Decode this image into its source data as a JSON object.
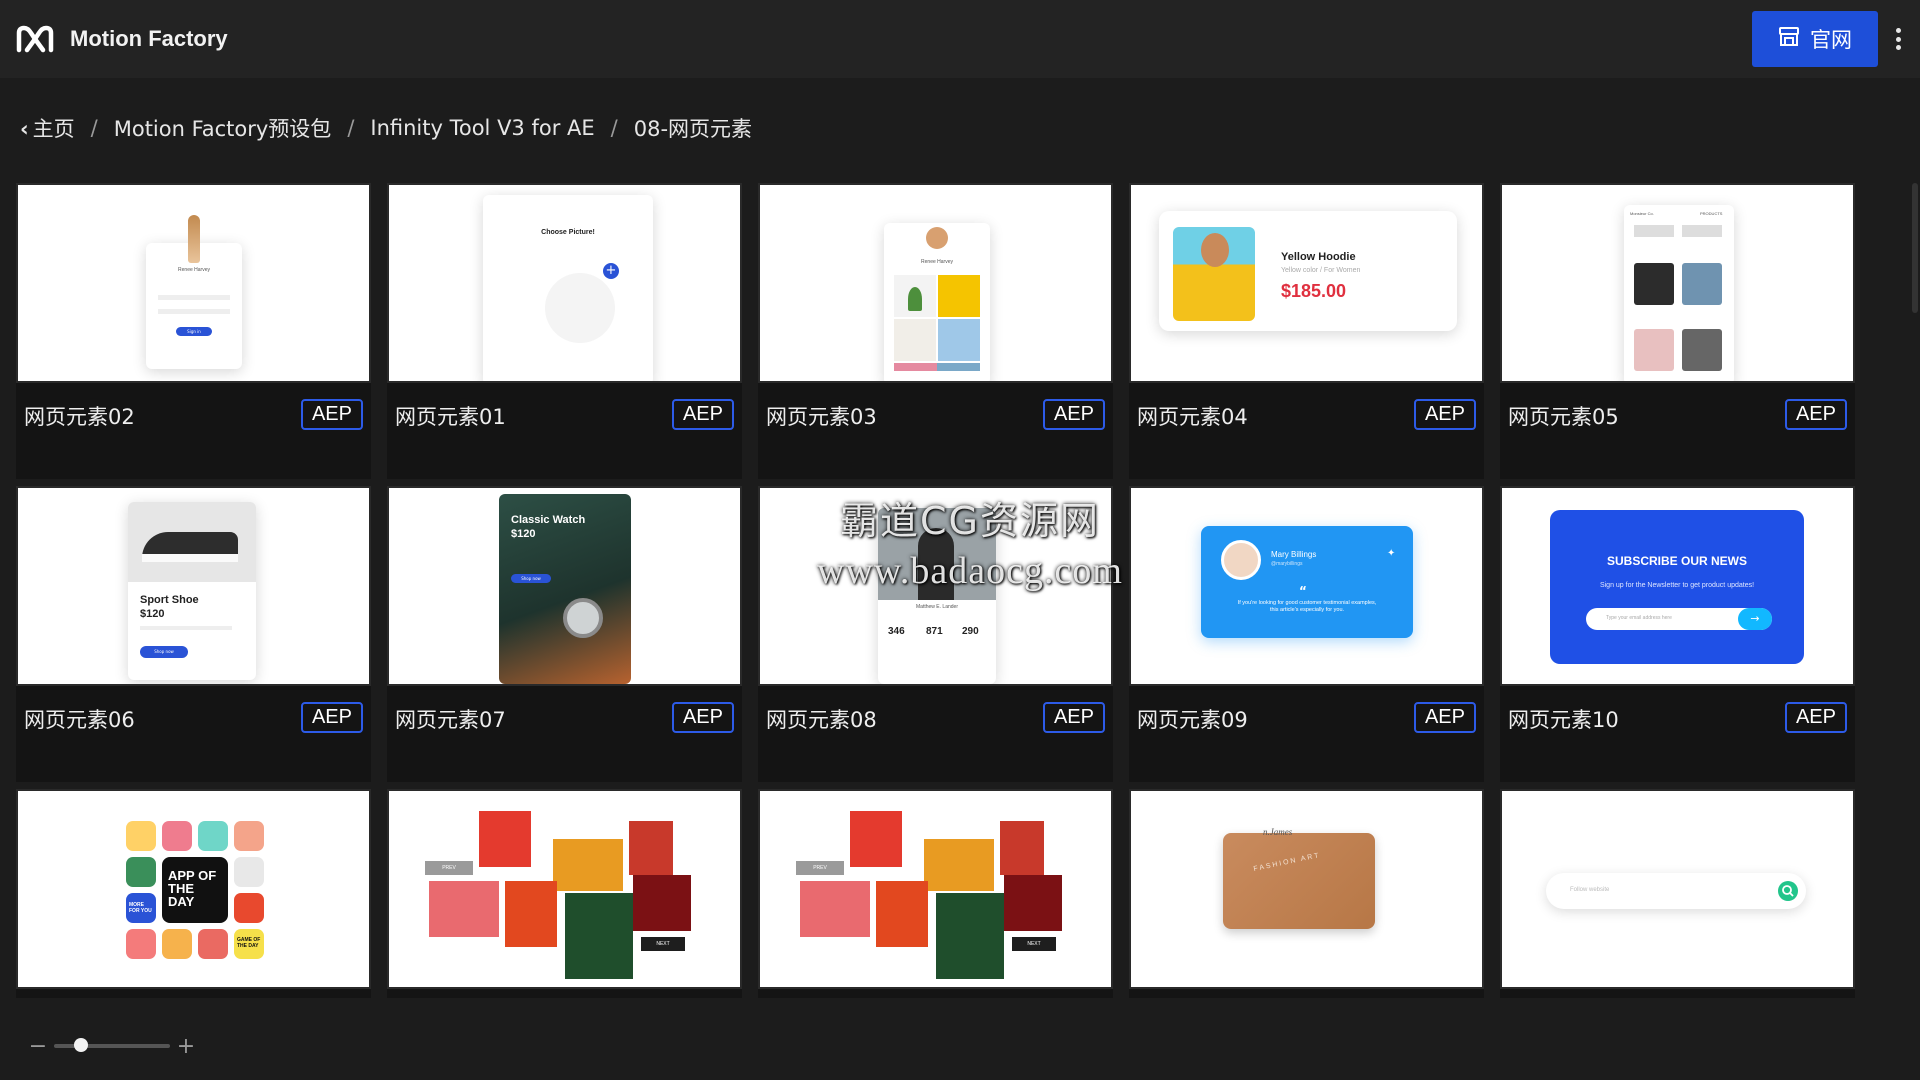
{
  "app": {
    "title": "Motion Factory"
  },
  "header": {
    "site_button_label": "官网"
  },
  "breadcrumb": {
    "items": [
      "主页",
      "Motion Factory预设包",
      "Infinity Tool V3 for AE",
      "08-网页元素"
    ],
    "separator": "/"
  },
  "cards": [
    {
      "name": "网页元素02",
      "badge": "AEP",
      "art": {
        "name": "Renee Harvey",
        "button": "Sign in"
      }
    },
    {
      "name": "网页元素01",
      "badge": "AEP",
      "art": {
        "title": "Choose Picture!"
      }
    },
    {
      "name": "网页元素03",
      "badge": "AEP",
      "art": {
        "name": "Renee Harvey"
      }
    },
    {
      "name": "网页元素04",
      "badge": "AEP",
      "art": {
        "title": "Yellow Hoodie",
        "subtitle": "Yellow color / For Women",
        "price": "$185.00"
      }
    },
    {
      "name": "网页元素05",
      "badge": "AEP",
      "art": {
        "left": "Monsieur Co.",
        "right": "PRODUCTS"
      }
    },
    {
      "name": "网页元素06",
      "badge": "AEP",
      "art": {
        "title": "Sport Shoe",
        "price": "$120",
        "button": "Shop now"
      }
    },
    {
      "name": "网页元素07",
      "badge": "AEP",
      "art": {
        "title": "Classic Watch",
        "price": "$120",
        "button": "Shop now"
      }
    },
    {
      "name": "网页元素08",
      "badge": "AEP",
      "art": {
        "name": "Matthew E. Lander",
        "stats": [
          "346",
          "871",
          "290"
        ]
      }
    },
    {
      "name": "网页元素09",
      "badge": "AEP",
      "art": {
        "name": "Mary Billings",
        "handle": "@marybillings",
        "quote": "If you're looking for good customer testimonial examples, this article's especially for you."
      }
    },
    {
      "name": "网页元素10",
      "badge": "AEP",
      "art": {
        "title": "SUBSCRIBE OUR NEWS",
        "subtitle": "Sign up for the Newsletter to get product updates!",
        "placeholder": "Type your email address here"
      }
    },
    {
      "name": "",
      "badge": "",
      "art": {
        "tile_main": "APP OF THE DAY",
        "tile_more": "MORE FOR YOU",
        "tile_game": "GAME OF THE DAY"
      }
    },
    {
      "name": "",
      "badge": "",
      "art": {
        "prev": "PREV",
        "next": "NEXT"
      }
    },
    {
      "name": "",
      "badge": "",
      "art": {
        "prev": "PREV",
        "next": "NEXT"
      }
    },
    {
      "name": "",
      "badge": "",
      "art": {
        "brand": "FASHION ART",
        "script": "n.James"
      }
    },
    {
      "name": "",
      "badge": "",
      "art": {
        "placeholder": "Follow website"
      }
    }
  ],
  "watermark": {
    "line1": "霸道CG资源网",
    "line2": "www.badaocg.com"
  },
  "zoom": {
    "minus": "−",
    "plus": "+",
    "level": 0.2
  },
  "colors": {
    "accent": "#1e4fd9",
    "badge_border": "#2d5be8",
    "background": "#1c1c1c"
  }
}
